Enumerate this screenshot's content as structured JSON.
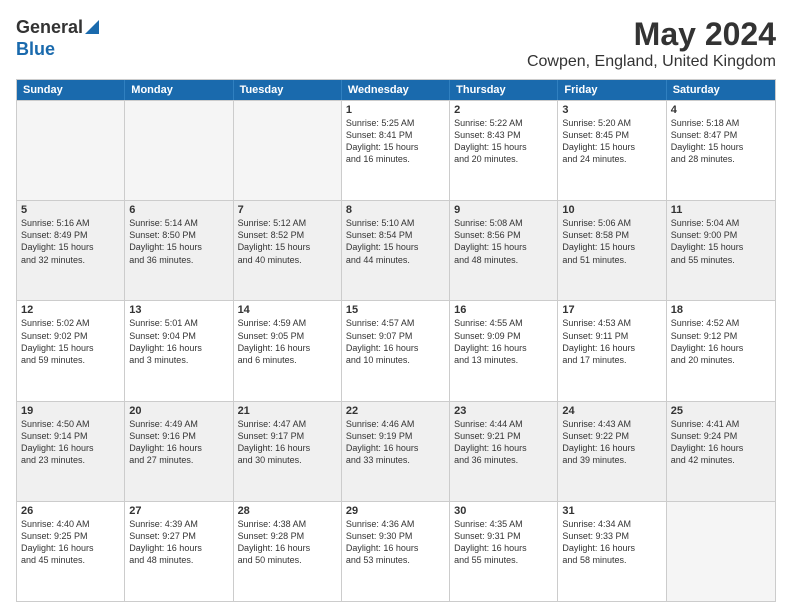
{
  "logo": {
    "general": "General",
    "blue": "Blue"
  },
  "title": "May 2024",
  "subtitle": "Cowpen, England, United Kingdom",
  "weekdays": [
    "Sunday",
    "Monday",
    "Tuesday",
    "Wednesday",
    "Thursday",
    "Friday",
    "Saturday"
  ],
  "rows": [
    [
      {
        "num": "",
        "text": "",
        "empty": true
      },
      {
        "num": "",
        "text": "",
        "empty": true
      },
      {
        "num": "",
        "text": "",
        "empty": true
      },
      {
        "num": "1",
        "text": "Sunrise: 5:25 AM\nSunset: 8:41 PM\nDaylight: 15 hours\nand 16 minutes."
      },
      {
        "num": "2",
        "text": "Sunrise: 5:22 AM\nSunset: 8:43 PM\nDaylight: 15 hours\nand 20 minutes."
      },
      {
        "num": "3",
        "text": "Sunrise: 5:20 AM\nSunset: 8:45 PM\nDaylight: 15 hours\nand 24 minutes."
      },
      {
        "num": "4",
        "text": "Sunrise: 5:18 AM\nSunset: 8:47 PM\nDaylight: 15 hours\nand 28 minutes."
      }
    ],
    [
      {
        "num": "5",
        "text": "Sunrise: 5:16 AM\nSunset: 8:49 PM\nDaylight: 15 hours\nand 32 minutes."
      },
      {
        "num": "6",
        "text": "Sunrise: 5:14 AM\nSunset: 8:50 PM\nDaylight: 15 hours\nand 36 minutes."
      },
      {
        "num": "7",
        "text": "Sunrise: 5:12 AM\nSunset: 8:52 PM\nDaylight: 15 hours\nand 40 minutes."
      },
      {
        "num": "8",
        "text": "Sunrise: 5:10 AM\nSunset: 8:54 PM\nDaylight: 15 hours\nand 44 minutes."
      },
      {
        "num": "9",
        "text": "Sunrise: 5:08 AM\nSunset: 8:56 PM\nDaylight: 15 hours\nand 48 minutes."
      },
      {
        "num": "10",
        "text": "Sunrise: 5:06 AM\nSunset: 8:58 PM\nDaylight: 15 hours\nand 51 minutes."
      },
      {
        "num": "11",
        "text": "Sunrise: 5:04 AM\nSunset: 9:00 PM\nDaylight: 15 hours\nand 55 minutes."
      }
    ],
    [
      {
        "num": "12",
        "text": "Sunrise: 5:02 AM\nSunset: 9:02 PM\nDaylight: 15 hours\nand 59 minutes."
      },
      {
        "num": "13",
        "text": "Sunrise: 5:01 AM\nSunset: 9:04 PM\nDaylight: 16 hours\nand 3 minutes."
      },
      {
        "num": "14",
        "text": "Sunrise: 4:59 AM\nSunset: 9:05 PM\nDaylight: 16 hours\nand 6 minutes."
      },
      {
        "num": "15",
        "text": "Sunrise: 4:57 AM\nSunset: 9:07 PM\nDaylight: 16 hours\nand 10 minutes."
      },
      {
        "num": "16",
        "text": "Sunrise: 4:55 AM\nSunset: 9:09 PM\nDaylight: 16 hours\nand 13 minutes."
      },
      {
        "num": "17",
        "text": "Sunrise: 4:53 AM\nSunset: 9:11 PM\nDaylight: 16 hours\nand 17 minutes."
      },
      {
        "num": "18",
        "text": "Sunrise: 4:52 AM\nSunset: 9:12 PM\nDaylight: 16 hours\nand 20 minutes."
      }
    ],
    [
      {
        "num": "19",
        "text": "Sunrise: 4:50 AM\nSunset: 9:14 PM\nDaylight: 16 hours\nand 23 minutes."
      },
      {
        "num": "20",
        "text": "Sunrise: 4:49 AM\nSunset: 9:16 PM\nDaylight: 16 hours\nand 27 minutes."
      },
      {
        "num": "21",
        "text": "Sunrise: 4:47 AM\nSunset: 9:17 PM\nDaylight: 16 hours\nand 30 minutes."
      },
      {
        "num": "22",
        "text": "Sunrise: 4:46 AM\nSunset: 9:19 PM\nDaylight: 16 hours\nand 33 minutes."
      },
      {
        "num": "23",
        "text": "Sunrise: 4:44 AM\nSunset: 9:21 PM\nDaylight: 16 hours\nand 36 minutes."
      },
      {
        "num": "24",
        "text": "Sunrise: 4:43 AM\nSunset: 9:22 PM\nDaylight: 16 hours\nand 39 minutes."
      },
      {
        "num": "25",
        "text": "Sunrise: 4:41 AM\nSunset: 9:24 PM\nDaylight: 16 hours\nand 42 minutes."
      }
    ],
    [
      {
        "num": "26",
        "text": "Sunrise: 4:40 AM\nSunset: 9:25 PM\nDaylight: 16 hours\nand 45 minutes."
      },
      {
        "num": "27",
        "text": "Sunrise: 4:39 AM\nSunset: 9:27 PM\nDaylight: 16 hours\nand 48 minutes."
      },
      {
        "num": "28",
        "text": "Sunrise: 4:38 AM\nSunset: 9:28 PM\nDaylight: 16 hours\nand 50 minutes."
      },
      {
        "num": "29",
        "text": "Sunrise: 4:36 AM\nSunset: 9:30 PM\nDaylight: 16 hours\nand 53 minutes."
      },
      {
        "num": "30",
        "text": "Sunrise: 4:35 AM\nSunset: 9:31 PM\nDaylight: 16 hours\nand 55 minutes."
      },
      {
        "num": "31",
        "text": "Sunrise: 4:34 AM\nSunset: 9:33 PM\nDaylight: 16 hours\nand 58 minutes."
      },
      {
        "num": "",
        "text": "",
        "empty": true
      }
    ]
  ]
}
